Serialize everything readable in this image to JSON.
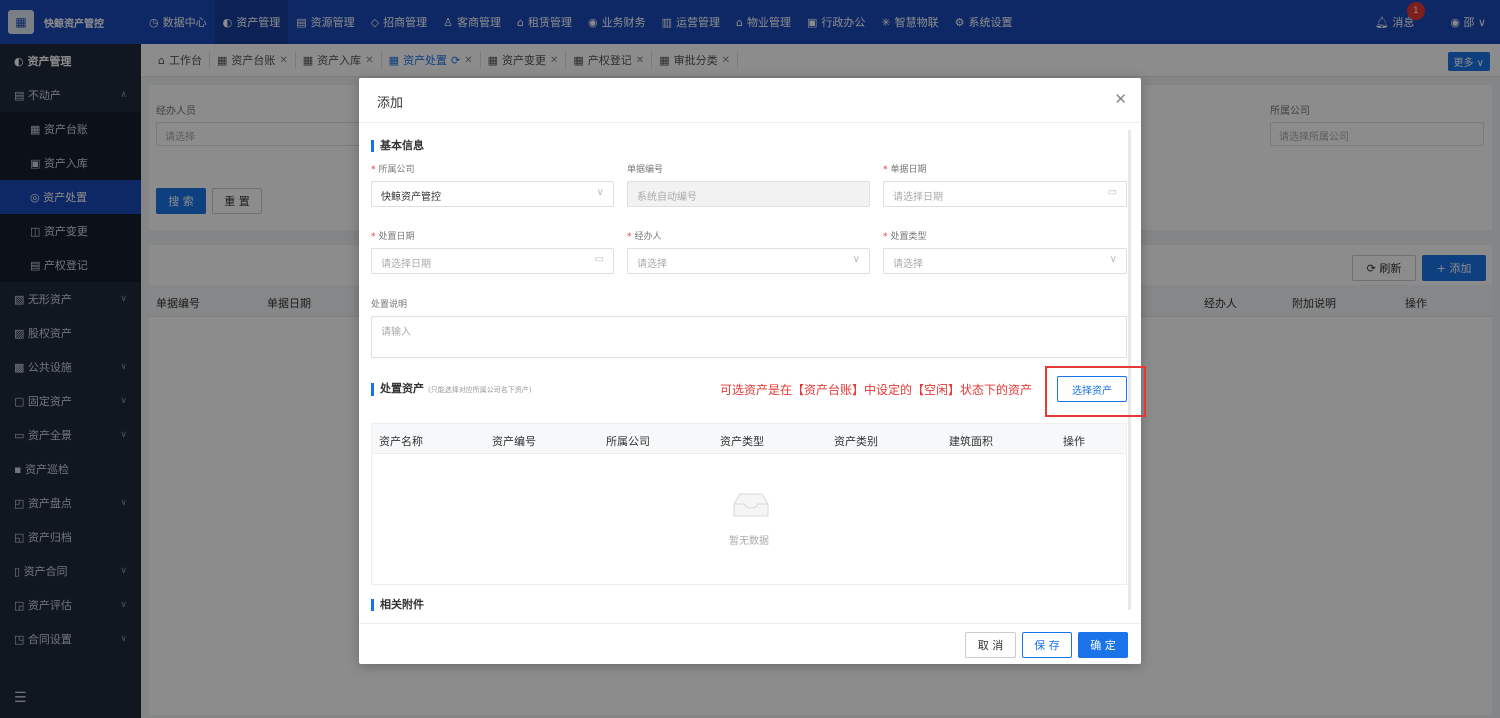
{
  "app": {
    "name": "快鲸资产管控"
  },
  "topnav": [
    {
      "icon": "dashboard-icon",
      "label": "数据中心"
    },
    {
      "icon": "asset-icon",
      "label": "资产管理",
      "active": true
    },
    {
      "icon": "building-icon",
      "label": "资源管理"
    },
    {
      "icon": "tag-icon",
      "label": "招商管理"
    },
    {
      "icon": "people-icon",
      "label": "客商管理"
    },
    {
      "icon": "house-icon",
      "label": "租赁管理"
    },
    {
      "icon": "coin-icon",
      "label": "业务财务"
    },
    {
      "icon": "chart-icon",
      "label": "运营管理"
    },
    {
      "icon": "home-icon",
      "label": "物业管理"
    },
    {
      "icon": "office-icon",
      "label": "行政办公"
    },
    {
      "icon": "iot-icon",
      "label": "智慧物联"
    },
    {
      "icon": "gear-icon",
      "label": "系统设置"
    }
  ],
  "topright": {
    "messages_label": "消息",
    "messages_count": "1",
    "user_label": "邵"
  },
  "sidebar": {
    "title": "资产管理",
    "items": [
      {
        "label": "不动产",
        "icon": "building-icon",
        "expanded": true
      },
      {
        "label": "资产台账",
        "icon": "ledger-icon",
        "sub": true
      },
      {
        "label": "资产入库",
        "icon": "inbox-icon",
        "sub": true
      },
      {
        "label": "资产处置",
        "icon": "dispose-icon",
        "sub": true,
        "selected": true
      },
      {
        "label": "资产变更",
        "icon": "change-icon",
        "sub": true
      },
      {
        "label": "产权登记",
        "icon": "register-icon",
        "sub": true
      },
      {
        "label": "无形资产",
        "icon": "intangible-icon",
        "arrow": true
      },
      {
        "label": "股权资产",
        "icon": "equity-icon"
      },
      {
        "label": "公共设施",
        "icon": "facility-icon",
        "arrow": true
      },
      {
        "label": "固定资产",
        "icon": "fixed-icon",
        "arrow": true
      },
      {
        "label": "资产全景",
        "icon": "panorama-icon",
        "arrow": true
      },
      {
        "label": "资产巡检",
        "icon": "inspect-icon"
      },
      {
        "label": "资产盘点",
        "icon": "inventory-icon",
        "arrow": true
      },
      {
        "label": "资产归档",
        "icon": "archive-icon"
      },
      {
        "label": "资产合同",
        "icon": "contract-icon",
        "arrow": true
      },
      {
        "label": "资产评估",
        "icon": "evaluate-icon",
        "arrow": true
      },
      {
        "label": "合同设置",
        "icon": "settings-icon",
        "arrow": true
      }
    ]
  },
  "tabs": [
    {
      "label": "工作台",
      "closable": false
    },
    {
      "label": "资产台账",
      "closable": true
    },
    {
      "label": "资产入库",
      "closable": true
    },
    {
      "label": "资产处置",
      "closable": true,
      "active": true
    },
    {
      "label": "资产变更",
      "closable": true
    },
    {
      "label": "产权登记",
      "closable": true
    },
    {
      "label": "审批分类",
      "closable": true
    }
  ],
  "tabbar": {
    "more_label": "更多 ∨"
  },
  "filters": {
    "handler_label": "经办人员",
    "handler_placeholder": "请选择",
    "company_label": "所属公司",
    "company_placeholder": "请选择所属公司",
    "search_label": "搜 索",
    "reset_label": "重 置"
  },
  "list": {
    "refresh_label": "刷新",
    "add_label": "+ 添加",
    "columns_left": [
      "单据编号",
      "单据日期"
    ],
    "columns_right": [
      "经办人",
      "附加说明",
      "操作"
    ]
  },
  "modal": {
    "title": "添加",
    "section_basic": "基本信息",
    "company_label": "所属公司",
    "company_value": "快鲸资产管控",
    "doc_no_label": "单据编号",
    "doc_no_placeholder": "系统自动编号",
    "doc_date_label": "单据日期",
    "doc_date_placeholder": "请选择日期",
    "dispose_date_label": "处置日期",
    "dispose_date_placeholder": "请选择日期",
    "handler_label": "经办人",
    "handler_placeholder": "请选择",
    "dispose_type_label": "处置类型",
    "dispose_type_placeholder": "请选择",
    "desc_label": "处置说明",
    "desc_placeholder": "请输入",
    "section_assets": "处置资产",
    "section_assets_hint": "(只能选择对应所属公司名下资产)",
    "note": "可选资产是在【资产台账】中设定的【空闲】状态下的资产",
    "select_assets_label": "选择资产",
    "table_columns": [
      "资产名称",
      "资产编号",
      "所属公司",
      "资产类型",
      "资产类别",
      "建筑面积",
      "操作"
    ],
    "empty_text": "暂无数据",
    "section_attach": "相关附件",
    "cancel_label": "取 消",
    "save_label": "保 存",
    "confirm_label": "确 定"
  },
  "colors": {
    "primary": "#1a73e8",
    "topbar": "#1a47b8",
    "sidebar": "#1f2a3d",
    "danger": "#e53935"
  }
}
